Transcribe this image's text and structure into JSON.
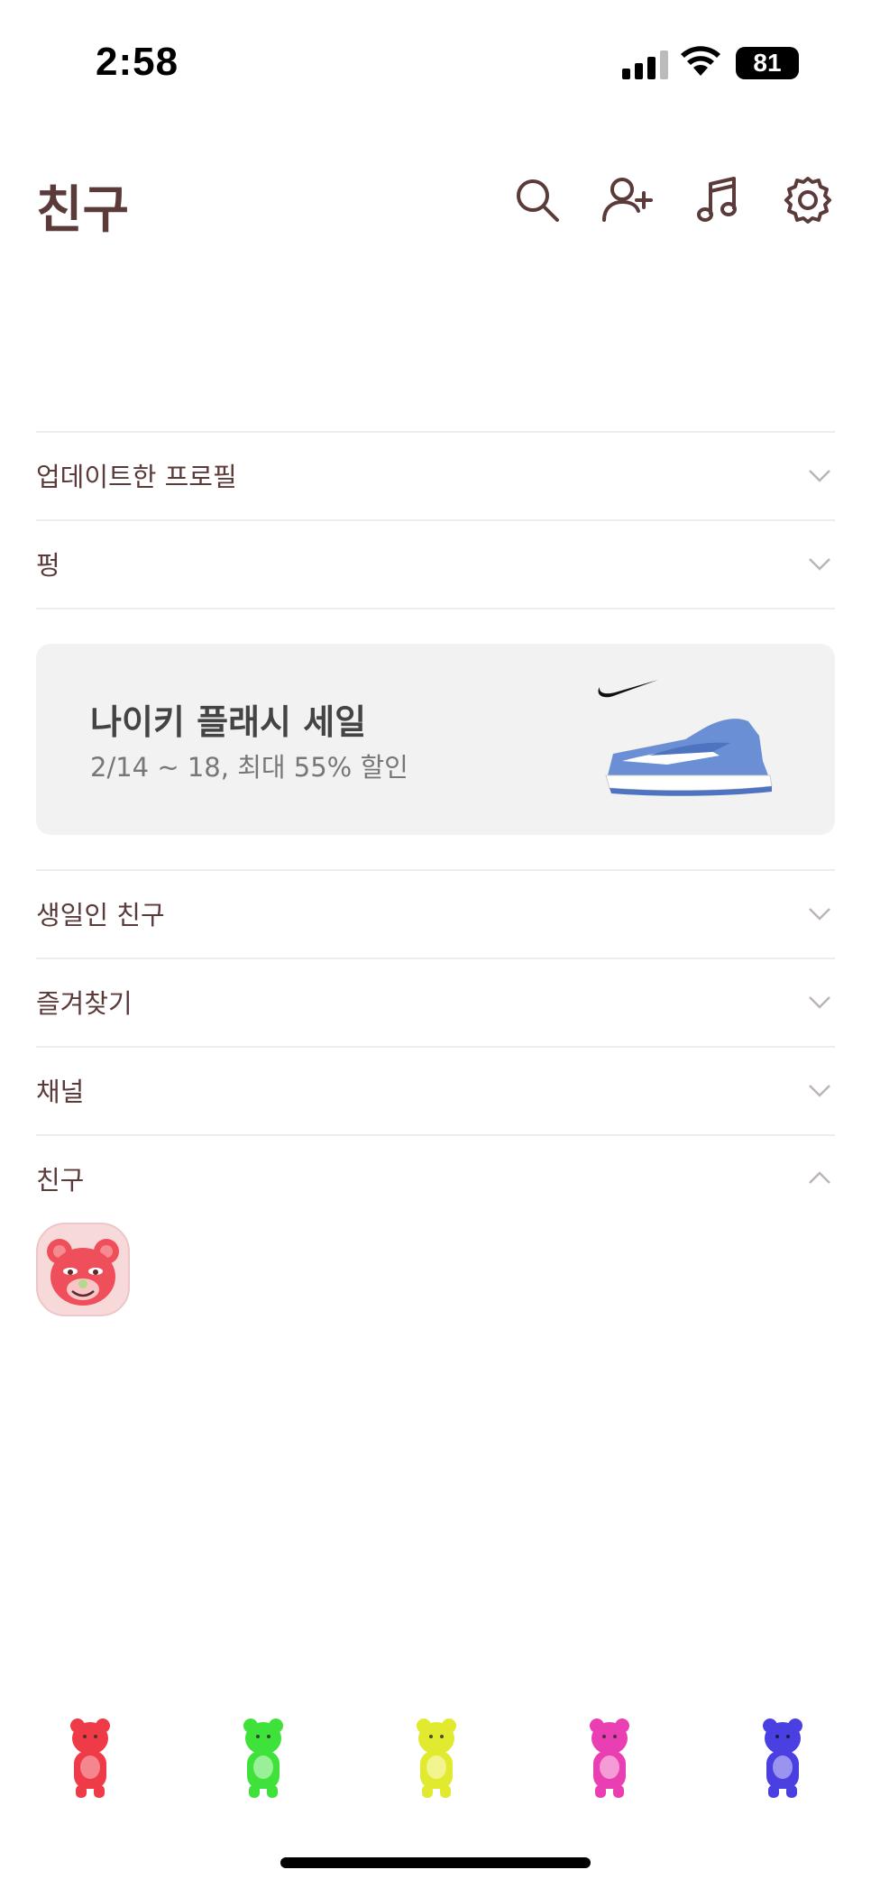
{
  "status_bar": {
    "time": "2:58",
    "battery": "81"
  },
  "header": {
    "title": "친구",
    "icons": [
      "search-icon",
      "add-friend-icon",
      "music-icon",
      "settings-icon"
    ]
  },
  "sections": {
    "updated_profiles": "업데이트한 프로필",
    "pung": "펑",
    "birthday_friends": "생일인 친구",
    "favorites": "즐겨찾기",
    "channels": "채널",
    "friends": "친구"
  },
  "banner": {
    "title": "나이키 플래시 세일",
    "subtitle": "2/14 ~ 18, 최대 55% 할인"
  },
  "tabbar": {
    "tabs": [
      "bear-red-icon",
      "bear-green-icon",
      "bear-yellow-icon",
      "bear-pink-icon",
      "bear-blue-icon"
    ],
    "colors": [
      "#ef3b48",
      "#3fe23a",
      "#e2ea2f",
      "#ea3fb3",
      "#4a3fe0"
    ]
  }
}
